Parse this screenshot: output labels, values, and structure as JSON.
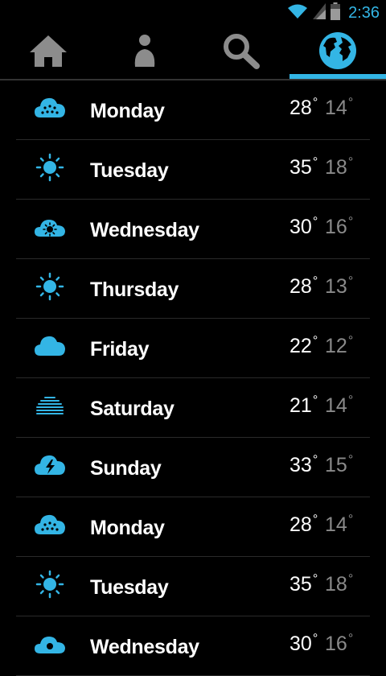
{
  "status_bar": {
    "time": "2:36"
  },
  "tabs": [
    {
      "icon": "home-icon"
    },
    {
      "icon": "person-icon"
    },
    {
      "icon": "search-icon"
    },
    {
      "icon": "globe-icon",
      "selected": true
    }
  ],
  "colors": {
    "accent": "#33b5e5",
    "low_temp": "#8a8a8a",
    "background": "#000000"
  },
  "forecast": [
    {
      "day": "Monday",
      "high": "28",
      "low": "14",
      "icon": "rain-cloud-icon"
    },
    {
      "day": "Tuesday",
      "high": "35",
      "low": "18",
      "icon": "sun-icon"
    },
    {
      "day": "Wednesday",
      "high": "30",
      "low": "16",
      "icon": "partly-cloudy-icon"
    },
    {
      "day": "Thursday",
      "high": "28",
      "low": "13",
      "icon": "sun-icon"
    },
    {
      "day": "Friday",
      "high": "22",
      "low": "12",
      "icon": "cloud-icon"
    },
    {
      "day": "Saturday",
      "high": "21",
      "low": "14",
      "icon": "fog-icon"
    },
    {
      "day": "Sunday",
      "high": "33",
      "low": "15",
      "icon": "thunderstorm-icon"
    },
    {
      "day": "Monday",
      "high": "28",
      "low": "14",
      "icon": "rain-cloud-icon"
    },
    {
      "day": "Tuesday",
      "high": "35",
      "low": "18",
      "icon": "sun-icon"
    },
    {
      "day": "Wednesday",
      "high": "30",
      "low": "16",
      "icon": "partly-cloudy-icon"
    }
  ]
}
